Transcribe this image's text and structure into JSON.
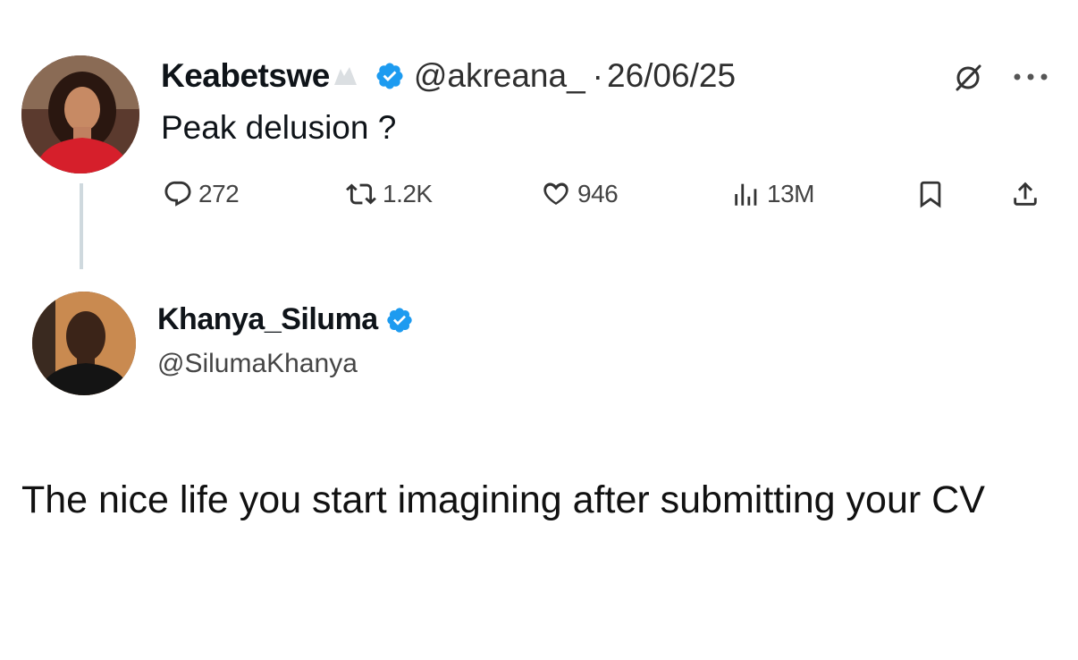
{
  "tweet": {
    "author": {
      "name": "Keabetswe",
      "handle": "@akreana_",
      "verified": true,
      "avatar": "woman-red-top-avatar"
    },
    "date_separator": "·",
    "date": "26/06/25",
    "text": "Peak delusion ?",
    "icons": [
      "grok-icon",
      "more-icon"
    ],
    "stats": {
      "replies": "272",
      "retweets": "1.2K",
      "likes": "946",
      "views": "13M"
    }
  },
  "reply": {
    "author": {
      "name": "Khanya_Siluma",
      "handle": "@SilumaKhanya",
      "verified": true,
      "avatar": "man-dark-shirt-avatar"
    },
    "text": "The nice life you start imagining after submitting your CV"
  },
  "colors": {
    "verified": "#1d9bf0",
    "thread_line": "#cfd9de",
    "text": "#0f1419",
    "secondary_text": "#536471"
  }
}
